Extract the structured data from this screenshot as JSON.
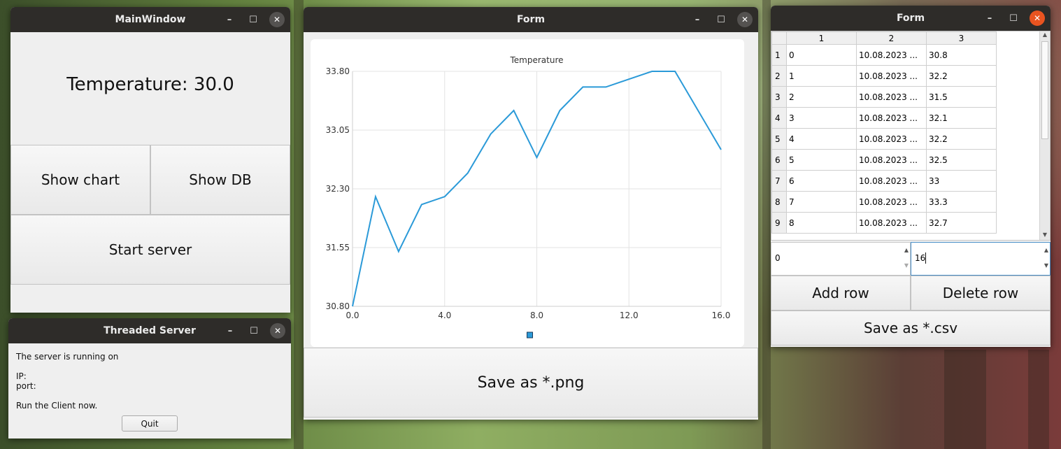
{
  "main_window": {
    "title": "MainWindow",
    "temperature": "Temperature: 30.0",
    "show_chart": "Show chart",
    "show_db": "Show DB",
    "start_server": "Start server"
  },
  "server_window": {
    "title": "Threaded Server",
    "line1": "The server is running on",
    "ip": "IP:",
    "port": "port:",
    "line3": "Run the Client now.",
    "quit": "Quit"
  },
  "chart_window": {
    "title": "Form",
    "save": "Save as *.png"
  },
  "chart_data": {
    "type": "line",
    "title": "Temperature",
    "x": [
      0,
      1,
      2,
      3,
      4,
      5,
      6,
      7,
      8,
      9,
      10,
      11,
      12,
      13,
      14,
      15,
      16
    ],
    "y": [
      30.8,
      32.2,
      31.5,
      32.1,
      32.2,
      32.5,
      33.0,
      33.3,
      32.7,
      33.3,
      33.6,
      33.6,
      33.7,
      33.8,
      33.8,
      33.3,
      32.8
    ],
    "xlim": [
      0,
      16
    ],
    "ylim": [
      30.8,
      33.8
    ],
    "x_ticks": [
      "0.0",
      "4.0",
      "8.0",
      "12.0",
      "16.0"
    ],
    "y_ticks": [
      "33.80",
      "33.05",
      "32.30",
      "31.55",
      "30.80"
    ],
    "grid": true,
    "series_color": "#2b9ad8"
  },
  "db_window": {
    "title": "Form",
    "columns": [
      "1",
      "2",
      "3"
    ],
    "rows": [
      {
        "n": "1",
        "c1": "0",
        "c2": "10.08.2023 ...",
        "c3": "30.8"
      },
      {
        "n": "2",
        "c1": "1",
        "c2": "10.08.2023 ...",
        "c3": "32.2"
      },
      {
        "n": "3",
        "c1": "2",
        "c2": "10.08.2023 ...",
        "c3": "31.5"
      },
      {
        "n": "4",
        "c1": "3",
        "c2": "10.08.2023 ...",
        "c3": "32.1"
      },
      {
        "n": "5",
        "c1": "4",
        "c2": "10.08.2023 ...",
        "c3": "32.2"
      },
      {
        "n": "6",
        "c1": "5",
        "c2": "10.08.2023 ...",
        "c3": "32.5"
      },
      {
        "n": "7",
        "c1": "6",
        "c2": "10.08.2023 ...",
        "c3": "33"
      },
      {
        "n": "8",
        "c1": "7",
        "c2": "10.08.2023 ...",
        "c3": "33.3"
      },
      {
        "n": "9",
        "c1": "8",
        "c2": "10.08.2023 ...",
        "c3": "32.7"
      }
    ],
    "spin_left": "0",
    "spin_right": "16",
    "add_row": "Add row",
    "delete_row": "Delete row",
    "save_csv": "Save as *.csv"
  }
}
